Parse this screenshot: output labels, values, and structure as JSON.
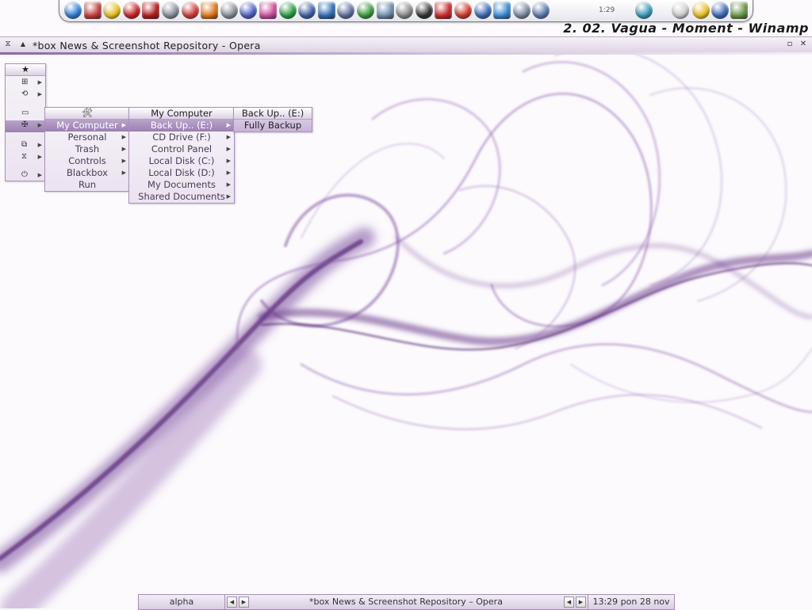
{
  "dock": {
    "clock": "1:29",
    "icons": [
      {
        "name": "opera-icon",
        "color": "#2f7fd8"
      },
      {
        "name": "calendar-icon",
        "color": "#c54040"
      },
      {
        "name": "lightning-icon",
        "color": "#e8c020"
      },
      {
        "name": "zone-icon",
        "color": "#cc2222"
      },
      {
        "name": "record-icon",
        "color": "#b81d1d"
      },
      {
        "name": "tools-icon",
        "color": "#8a8f99"
      },
      {
        "name": "shape-icon",
        "color": "#d43a3a"
      },
      {
        "name": "firefox-icon",
        "color": "#e07a1a"
      },
      {
        "name": "pen-icon",
        "color": "#8a8f99"
      },
      {
        "name": "notes-icon",
        "color": "#5060c8"
      },
      {
        "name": "palette-icon",
        "color": "#d050a0"
      },
      {
        "name": "play-icon",
        "color": "#28a040"
      },
      {
        "name": "monitor-icon",
        "color": "#4060a8"
      },
      {
        "name": "graphics-icon",
        "color": "#3070b8"
      },
      {
        "name": "hammer-icon",
        "color": "#6070a0"
      },
      {
        "name": "gear-icon",
        "color": "#3a9a3a"
      },
      {
        "name": "wrench-icon",
        "color": "#7090b0"
      },
      {
        "name": "settings-icon",
        "color": "#8a8a8a"
      },
      {
        "name": "disc-icon",
        "color": "#333333"
      },
      {
        "name": "shield-icon",
        "color": "#cc2a2a"
      },
      {
        "name": "antivirus-icon",
        "color": "#d03a2a"
      },
      {
        "name": "globe-icon",
        "color": "#3a6ab8"
      },
      {
        "name": "browser-icon",
        "color": "#3a8ad8"
      },
      {
        "name": "tools2-icon",
        "color": "#7a8aa0"
      },
      {
        "name": "network-icon",
        "color": "#5a7ab0"
      }
    ],
    "right_icons": [
      {
        "name": "sphere-icon",
        "color": "#3a9ab8"
      },
      {
        "name": "flower-icon",
        "color": "#cfcfcf"
      },
      {
        "name": "lightning2-icon",
        "color": "#e8c020"
      },
      {
        "name": "globe2-icon",
        "color": "#3a6ab8"
      },
      {
        "name": "window-icon",
        "color": "#6a9a4a"
      }
    ]
  },
  "winamp_title": "2. 02. Vagua - Moment - Winamp",
  "window": {
    "title": "*box News & Screenshot Repository - Opera",
    "minimize_label": "▫",
    "close_label": "✕",
    "sys_label": "⧖",
    "shade_label": "▲"
  },
  "menu_root": {
    "title": "★",
    "items": [
      {
        "icon": "grid-icon",
        "glyph": "⊞"
      },
      {
        "icon": "refresh-icon",
        "glyph": "⟲"
      },
      {
        "icon": "folder-icon",
        "glyph": "▭"
      },
      {
        "icon": "tools-menu-icon",
        "glyph": "✠"
      },
      {
        "icon": "windows-icon",
        "glyph": "⧉"
      },
      {
        "icon": "hourglass-icon",
        "glyph": "⧖"
      },
      {
        "icon": "power-icon",
        "glyph": "⏻"
      }
    ]
  },
  "menu_tools": {
    "title": "🛠",
    "items": [
      "My Computer",
      "Personal",
      "Trash",
      "Controls",
      "Blackbox",
      "Run"
    ]
  },
  "menu_computer": {
    "title": "My Computer",
    "items": [
      "Back Up.. (E:)",
      "CD Drive (F:)",
      "Control Panel",
      "Local Disk (C:)",
      "Local Disk (D:)",
      "My Documents",
      "Shared Documents"
    ]
  },
  "menu_backup": {
    "title": "Back Up.. (E:)",
    "items": [
      "Fully Backup"
    ]
  },
  "taskbar": {
    "workspace": "alpha",
    "task": "*box News & Screenshot Repository – Opera",
    "clock": "13:29 pon 28 nov",
    "prev": "◀",
    "next": "▶"
  },
  "colors": {
    "accent": "#9b7fb2",
    "menu_bg": "#f7f3f9",
    "smoke": "#7a4a9a"
  }
}
